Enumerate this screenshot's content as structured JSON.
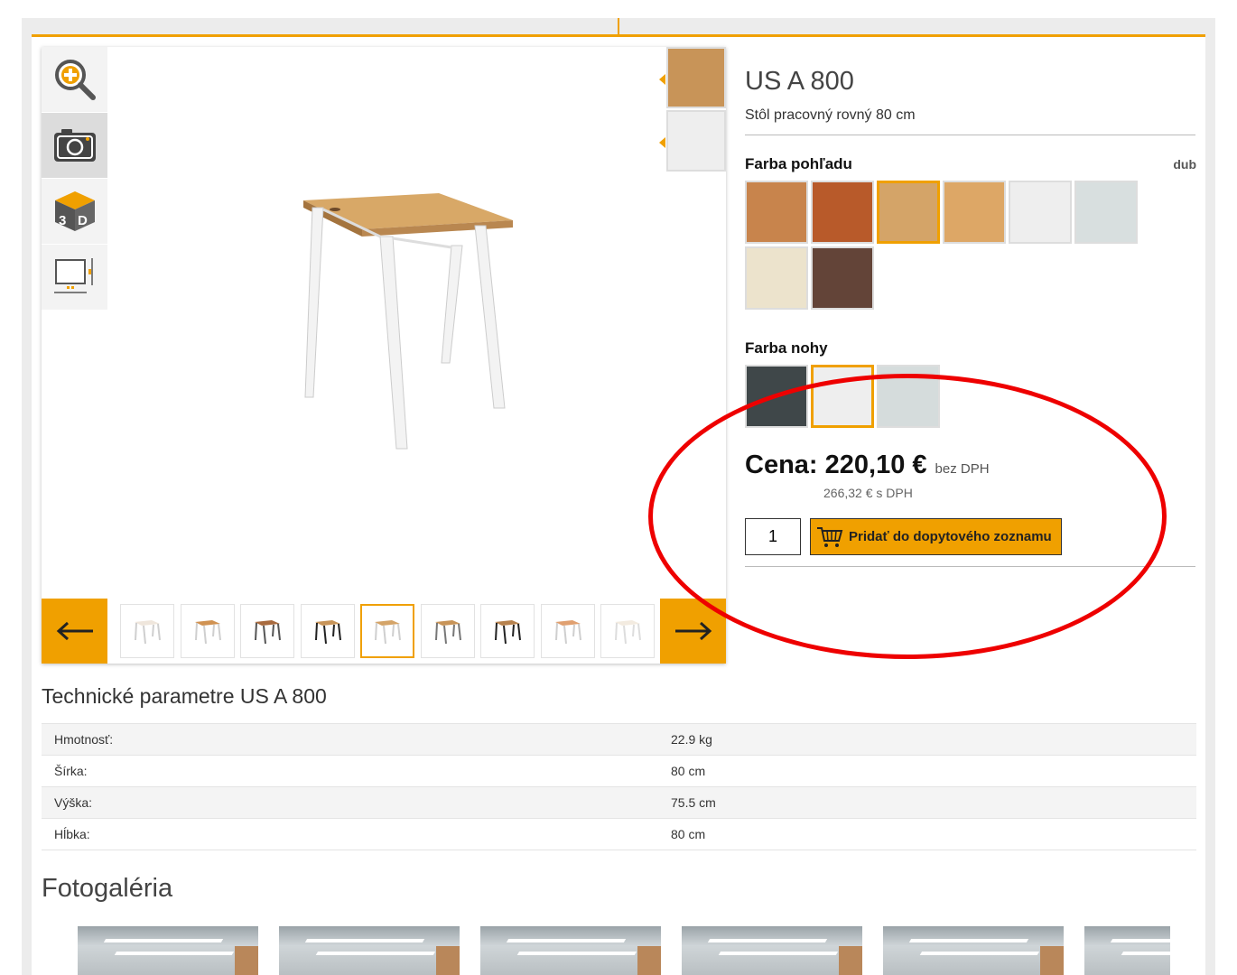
{
  "product": {
    "title": "US A 800",
    "subtitle": "Stôl pracovný rovný 80 cm"
  },
  "options": {
    "top_color": {
      "label": "Farba pohľadu",
      "value": "dub",
      "swatches": [
        "#c8844c",
        "#b85a2a",
        "#d4a468",
        "#dda766",
        "#eeeeee",
        "#d8dfdf",
        "#ece3cc",
        "#634438"
      ],
      "selected_index": 2
    },
    "leg_color": {
      "label": "Farba nohy",
      "swatches": [
        "#3f4749",
        "#eeeeee",
        "#d5dcdc"
      ],
      "selected_index": 1
    }
  },
  "viewer": {
    "tools": [
      "zoom-icon",
      "camera-icon",
      "3d-icon",
      "dimensions-icon"
    ],
    "active_tool": 1,
    "side_swatches": [
      "#c89458",
      "#eeeeee"
    ],
    "thumbnails": [
      {
        "top": "#efe6dc",
        "legs": "#cfcfcf"
      },
      {
        "top": "#d09252",
        "legs": "#cfcfcf"
      },
      {
        "top": "#a86a3e",
        "legs": "#555555"
      },
      {
        "top": "#c89458",
        "legs": "#222222"
      },
      {
        "top": "#d4a468",
        "legs": "#cfcfcf"
      },
      {
        "top": "#c89458",
        "legs": "#777777"
      },
      {
        "top": "#b7824e",
        "legs": "#222222"
      },
      {
        "top": "#e0a070",
        "legs": "#cfcfcf"
      },
      {
        "top": "#f3ebe0",
        "legs": "#dddddd"
      }
    ],
    "selected_thumbnail": 4
  },
  "price": {
    "main": "Cena: 220,10 €",
    "note": "bez DPH",
    "with_vat": "266,32 € s DPH"
  },
  "cart": {
    "quantity": "1",
    "add_label": "Pridať do dopytového zoznamu"
  },
  "tech": {
    "title": "Technické parametre US A 800",
    "rows": [
      {
        "key": "Hmotnosť:",
        "value": "22.9 kg"
      },
      {
        "key": "Šírka:",
        "value": "80 cm"
      },
      {
        "key": "Výška:",
        "value": "75.5 cm"
      },
      {
        "key": "Hĺbka:",
        "value": "80 cm"
      }
    ]
  },
  "gallery": {
    "title": "Fotogaléria",
    "count": 6
  },
  "colors": {
    "accent": "#f0a000",
    "annotation": "#ee0000"
  }
}
